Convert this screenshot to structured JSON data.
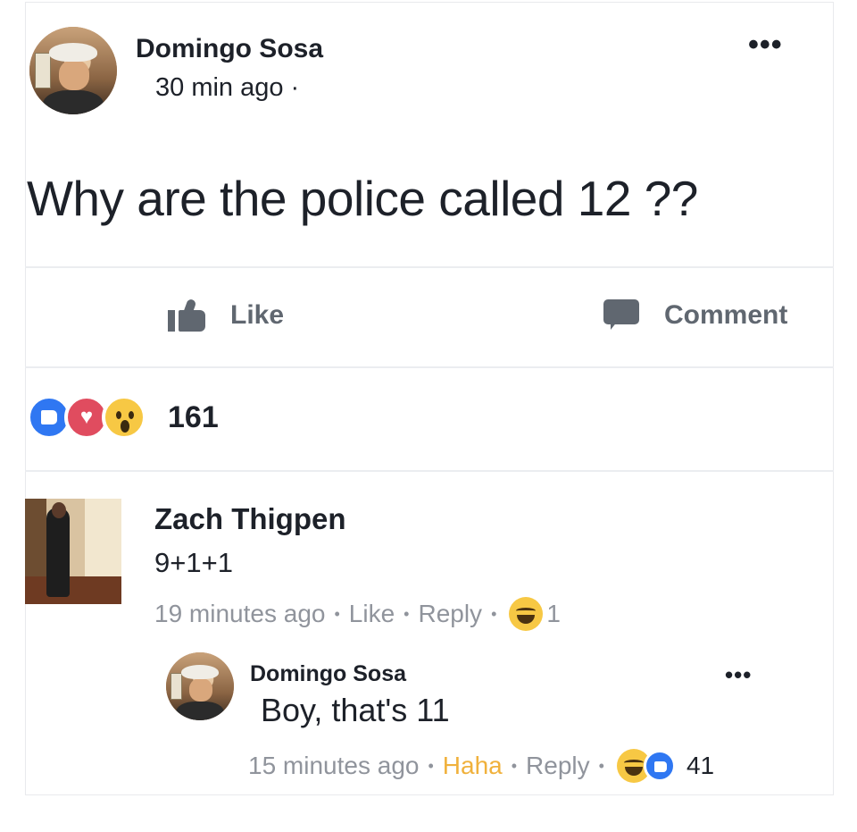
{
  "post": {
    "author": "Domingo Sosa",
    "time": "30 min ago ·",
    "text": "Why are the police called 12 ??",
    "more": "•••"
  },
  "actions": {
    "like_label": "Like",
    "comment_label": "Comment"
  },
  "reactions": {
    "count": "161",
    "types": [
      "like",
      "love",
      "wow"
    ]
  },
  "comments": [
    {
      "author": "Zach Thigpen",
      "text": "9+1+1",
      "time": "19 minutes ago",
      "like_label": "Like",
      "reply_label": "Reply",
      "reaction_count": "1"
    }
  ],
  "reply": {
    "author": "Domingo Sosa",
    "text": "Boy, that's 11",
    "time": "15 minutes ago",
    "haha_label": "Haha",
    "reply_label": "Reply",
    "reaction_count": "41",
    "more": "•••"
  },
  "colors": {
    "meta_gray": "#90949c",
    "action_gray": "#606770",
    "facebook_blue": "#2f77f2",
    "love_red": "#e04c5f",
    "haha_orange": "#f0b13c"
  }
}
